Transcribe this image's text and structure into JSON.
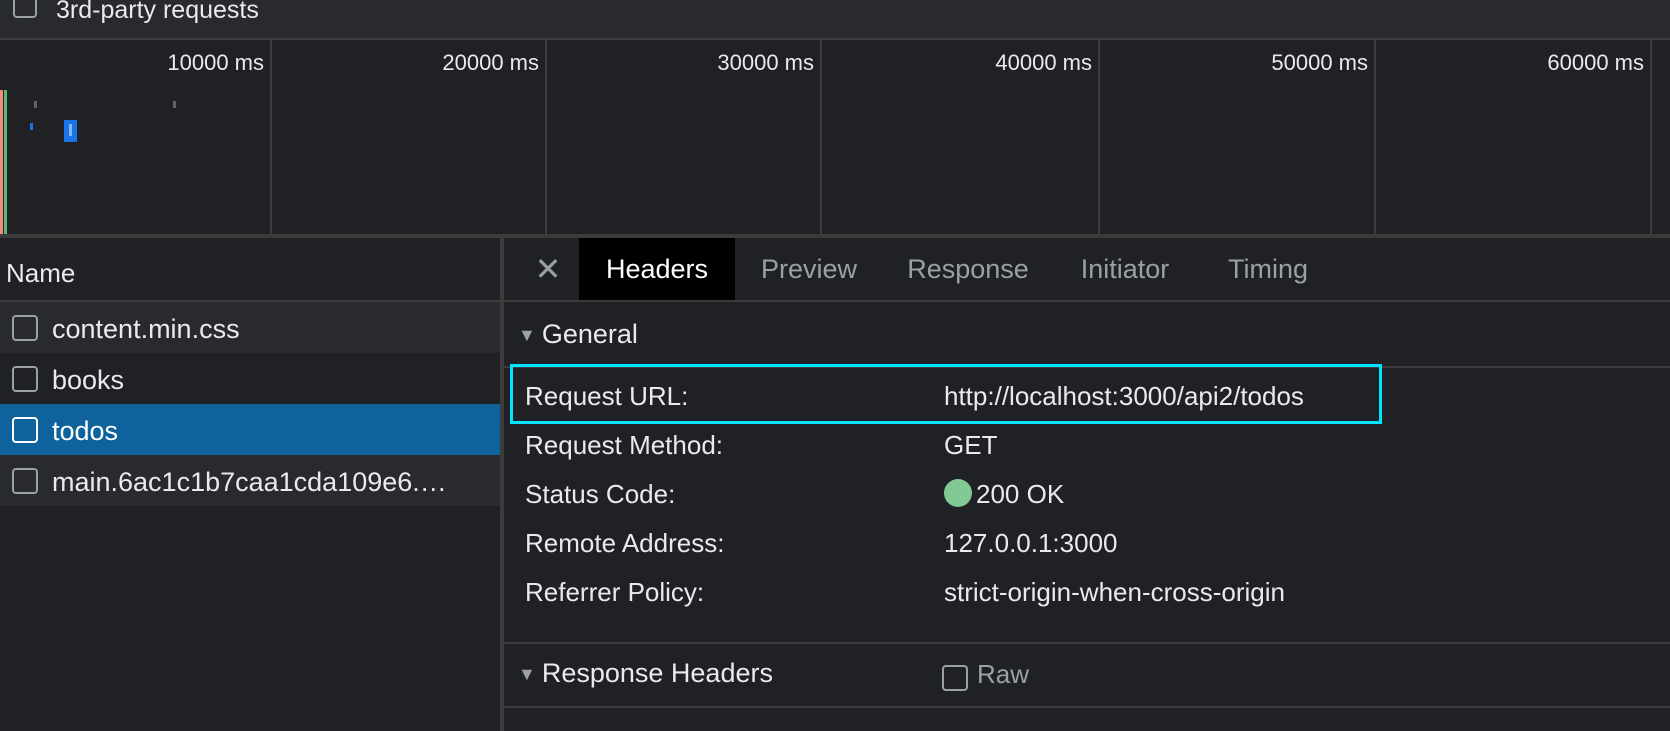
{
  "filters": {
    "third_party_label": "3rd-party requests"
  },
  "timeline": {
    "ticks": [
      "10000 ms",
      "20000 ms",
      "30000 ms",
      "40000 ms",
      "50000 ms",
      "60000 ms"
    ]
  },
  "request_list": {
    "header": "Name",
    "rows": [
      {
        "name": "content.min.css"
      },
      {
        "name": "books"
      },
      {
        "name": "todos"
      },
      {
        "name": "main.6ac1c1b7caa1cda109e6.…"
      }
    ],
    "selected_index": 2
  },
  "detail_tabs": {
    "close_glyph": "✕",
    "tabs": [
      "Headers",
      "Preview",
      "Response",
      "Initiator",
      "Timing"
    ],
    "active": "Headers"
  },
  "general": {
    "title": "General",
    "rows": [
      {
        "key": "Request URL:",
        "value": "http://localhost:3000/api2/todos"
      },
      {
        "key": "Request Method:",
        "value": "GET"
      },
      {
        "key": "Status Code:",
        "value": "200 OK"
      },
      {
        "key": "Remote Address:",
        "value": "127.0.0.1:3000"
      },
      {
        "key": "Referrer Policy:",
        "value": "strict-origin-when-cross-origin"
      }
    ]
  },
  "response_headers": {
    "title": "Response Headers",
    "raw_label": "Raw"
  },
  "colors": {
    "accent_selected": "#0e639c",
    "highlight": "#00e5ff",
    "status_ok": "#81c995"
  }
}
